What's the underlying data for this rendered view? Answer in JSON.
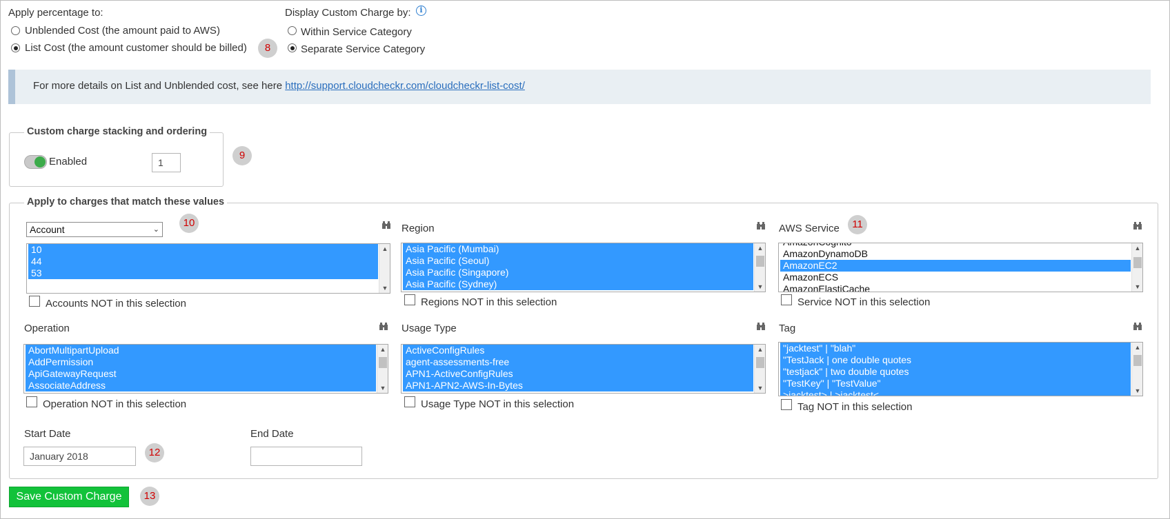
{
  "apply_percentage": {
    "label": "Apply percentage to:",
    "options": [
      {
        "label": "Unblended Cost (the amount paid to AWS)",
        "checked": false
      },
      {
        "label": "List Cost (the amount customer should be billed)",
        "checked": true
      }
    ],
    "badge": "8"
  },
  "display_charge": {
    "label": "Display Custom Charge by:",
    "info_icon": "info-icon",
    "options": [
      {
        "label": "Within Service Category",
        "checked": false
      },
      {
        "label": "Separate Service Category",
        "checked": true
      }
    ]
  },
  "info_bar": {
    "text": "For more details on List and Unblended cost, see here ",
    "link": "http://support.cloudcheckr.com/cloudcheckr-list-cost/"
  },
  "stacking": {
    "legend": "Custom charge stacking and ordering",
    "toggle_label": "Enabled",
    "toggle_on": true,
    "order_value": "1",
    "badge": "9"
  },
  "match": {
    "legend": "Apply to charges that match these values",
    "account": {
      "select_value": "Account",
      "badge": "10",
      "items": [
        "10",
        "44",
        "53"
      ],
      "selected": [
        true,
        true,
        true
      ],
      "not_label": "Accounts NOT in this selection"
    },
    "region": {
      "label": "Region",
      "items": [
        "Asia Pacific (Mumbai)",
        "Asia Pacific (Seoul)",
        "Asia Pacific (Singapore)",
        "Asia Pacific (Sydney)"
      ],
      "selected": [
        true,
        true,
        true,
        true
      ],
      "not_label": "Regions NOT in this selection"
    },
    "aws_service": {
      "label": "AWS Service",
      "badge": "11",
      "items": [
        "AmazonCognito",
        "AmazonDynamoDB",
        "AmazonEC2",
        "AmazonECS",
        "AmazonElastiCache"
      ],
      "selected": [
        false,
        false,
        true,
        false,
        false
      ],
      "not_label": "Service NOT in this selection"
    },
    "operation": {
      "label": "Operation",
      "items": [
        "AbortMultipartUpload",
        "AddPermission",
        "ApiGatewayRequest",
        "AssociateAddress"
      ],
      "selected": [
        true,
        true,
        true,
        true
      ],
      "not_label": "Operation NOT in this selection"
    },
    "usage_type": {
      "label": "Usage Type",
      "items": [
        "ActiveConfigRules",
        "agent-assessments-free",
        "APN1-ActiveConfigRules",
        "APN1-APN2-AWS-In-Bytes"
      ],
      "selected": [
        true,
        true,
        true,
        true
      ],
      "not_label": "Usage Type NOT in this selection"
    },
    "tag": {
      "label": "Tag",
      "items": [
        "\"jacktest\" | \"blah\"",
        "\"TestJack | one double quotes",
        "\"testjack\" | two double quotes",
        "\"TestKey\" | \"TestValue\"",
        ">jacktest> | >jacktest<"
      ],
      "selected": [
        true,
        true,
        true,
        true,
        true
      ],
      "not_label": "Tag NOT in this selection"
    },
    "start_date": {
      "label": "Start Date",
      "value": "January 2018",
      "badge": "12"
    },
    "end_date": {
      "label": "End Date",
      "value": ""
    }
  },
  "save": {
    "label": "Save Custom Charge",
    "badge": "13"
  },
  "colors": {
    "accent_green": "#12c23a",
    "selection_blue": "#3399ff",
    "badge_red": "#d00000"
  },
  "icons": {
    "finder": "binoculars-icon",
    "info": "info-icon"
  }
}
